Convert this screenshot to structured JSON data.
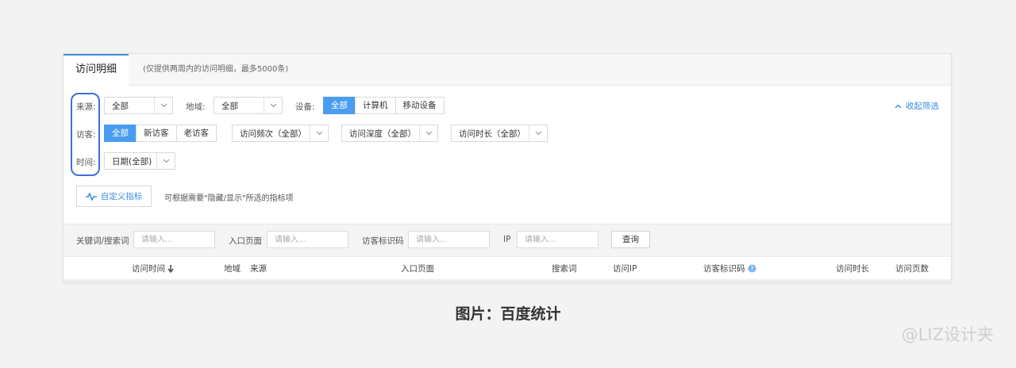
{
  "tabs": {
    "active": "访问明细",
    "note": "(仅提供两周内的访问明细，最多5000条)"
  },
  "filters": {
    "source": {
      "label": "来源:",
      "value": "全部"
    },
    "region": {
      "label": "地域:",
      "value": "全部"
    },
    "device": {
      "label": "设备:",
      "options": [
        "全部",
        "计算机",
        "移动设备"
      ],
      "selected": "全部"
    },
    "visitor": {
      "label": "访客:",
      "options": [
        "全部",
        "新访客",
        "老访客"
      ],
      "selected": "全部"
    },
    "frequency": {
      "value": "访问频次（全部）"
    },
    "depth": {
      "value": "访问深度（全部）"
    },
    "duration": {
      "value": "访问时长（全部）"
    },
    "time": {
      "label": "时间:",
      "value": "日期(全部)"
    },
    "collapse_link": "收起筛选"
  },
  "custom_metrics": {
    "button": "自定义指标",
    "hint": "可根据需要\"隐藏/显示\"所选的指标项"
  },
  "search": {
    "keyword": {
      "label": "关键词/搜索词",
      "placeholder": "请输入..."
    },
    "entry": {
      "label": "入口页面",
      "placeholder": "请输入..."
    },
    "visitor_id": {
      "label": "访客标识码",
      "placeholder": "请输入..."
    },
    "ip": {
      "label": "IP",
      "placeholder": "请输入..."
    },
    "query_button": "查询"
  },
  "columns": [
    "访问时间",
    "地域",
    "来源",
    "入口页面",
    "搜索词",
    "访问IP",
    "访客标识码",
    "访问时长",
    "访问页数"
  ],
  "caption": "图片：百度统计",
  "watermark": "@LIZ设计夹",
  "colors": {
    "accent": "#4a9cf0",
    "highlight": "#3d6fdb"
  }
}
